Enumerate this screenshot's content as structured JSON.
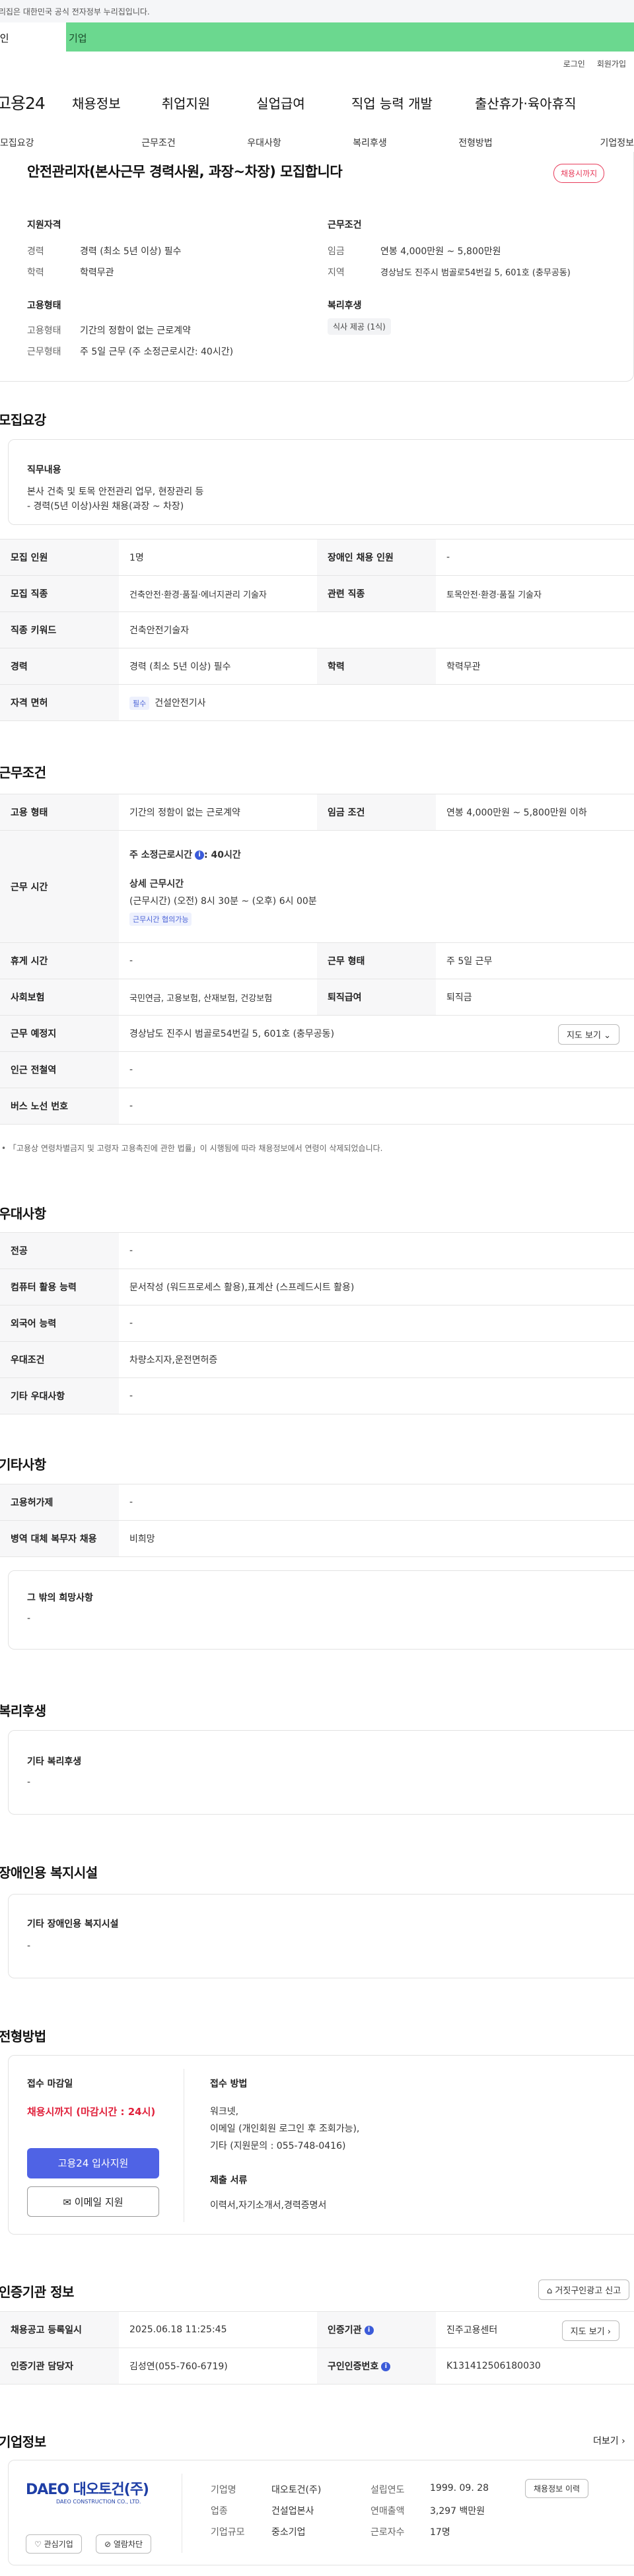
{
  "topbar": {
    "notice": "이 누리집은 대한민국 공식 전자정부 누리집입니다."
  },
  "audience": {
    "personal": "개인",
    "company": "기업"
  },
  "util": {
    "login": "로그인",
    "signup": "회원가입"
  },
  "gnb": {
    "logo": "고용24",
    "items": [
      "채용정보",
      "취업지원",
      "실업급여",
      "직업 능력 개발",
      "출산휴가·육아휴직"
    ]
  },
  "tabs": [
    "모집요강",
    "근무조건",
    "우대사항",
    "복리후생",
    "전형방법",
    "기업정보"
  ],
  "summary": {
    "title": "안전관리자(본사근무 경력사원, 과장~차장) 모집합니다",
    "badge": "채용시까지",
    "qual_heading": "지원자격",
    "career_label": "경력",
    "career_value": "경력 (최소 5년 이상) 필수",
    "edu_label": "학력",
    "edu_value": "학력무관",
    "cond_heading": "근무조건",
    "wage_label": "임금",
    "wage_value": "연봉 4,000만원 ~ 5,800만원",
    "region_label": "지역",
    "region_value": "경상남도 진주시 범골로54번길 5, 601호 (충무공동)",
    "emp_heading": "고용형태",
    "emptype_label": "고용형태",
    "emptype_value": "기간의 정함이 없는 근로계약",
    "worktype_label": "근무형태",
    "worktype_value": "주 5일 근무 (주 소정근로시간: 40시간)",
    "welfare_heading": "복리후생",
    "welfare_tag": "식사 제공 (1식)"
  },
  "recruit": {
    "heading": "모집요강",
    "duty_heading": "직무내용",
    "duty_line1": "본사 건축 및 토목 안전관리 업무, 현장관리 등",
    "duty_line2": "- 경력(5년 이상)사원 채용(과장 ~ 차장)",
    "rows": {
      "headcount_l": "모집 인원",
      "headcount_v": "1명",
      "disabled_l": "장애인 채용 인원",
      "disabled_v": "-",
      "job_l": "모집 직종",
      "job_v": "건축안전·환경·품질·에너지관리 기술자",
      "related_l": "관련 직종",
      "related_v": "토목안전·환경·품질 기술자",
      "keyword_l": "직종 키워드",
      "keyword_v": "건축안전기술자",
      "career_l": "경력",
      "career_v": "경력 (최소 5년 이상) 필수",
      "edu_l": "학력",
      "edu_v": "학력무관",
      "license_l": "자격 면허",
      "license_tag": "필수",
      "license_v": "건설안전기사"
    }
  },
  "workcond": {
    "heading": "근무조건",
    "emptype_l": "고용 형태",
    "emptype_v": "기간의 정함이 없는 근로계약",
    "wage_l": "임금 조건",
    "wage_v": "연봉 4,000만원 ~ 5,800만원 이하",
    "hours_l": "근무 시간",
    "weekly_label": "주 소정근로시간",
    "weekly_value": ": 40시간",
    "detail_label": "상세 근무시간",
    "detail_value": "(근무시간) (오전) 8시 30분 ~ (오후) 6시 00분",
    "consult_tag": "근무시간 협의가능",
    "holiday_l": "휴게 시간",
    "holiday_v": "-",
    "shift_l": "근무 형태",
    "shift_v": "주 5일 근무",
    "insurance_l": "사회보험",
    "insurance_v": "국민연금, 고용보험, 산재보험, 건강보험",
    "retire_l": "퇴직급여",
    "retire_v": "퇴직금",
    "place_l": "근무 예정지",
    "place_v": "경상남도 진주시 범골로54번길 5, 601호 (충무공동)",
    "map_btn": "지도 보기",
    "station_l": "인근 전철역",
    "station_v": "-",
    "bus_l": "버스 노선 번호",
    "bus_v": "-",
    "footnote": "「고용상 연령차별금지 및 고령자 고용촉진에 관한 법률」이 시행됨에 따라 채용정보에서 연령이 삭제되었습니다."
  },
  "pref": {
    "heading": "우대사항",
    "major_l": "전공",
    "major_v": "-",
    "computer_l": "컴퓨터 활용 능력",
    "computer_v": "문서작성 (워드프로세스 활용),표계산 (스프레드시트 활용)",
    "lang_l": "외국어 능력",
    "lang_v": "-",
    "cond_l": "우대조건",
    "cond_v": "차량소지자,운전면허증",
    "etc_l": "기타 우대사항",
    "etc_v": "-"
  },
  "other": {
    "heading": "기타사항",
    "permit_l": "고용허가제",
    "permit_v": "-",
    "military_l": "병역 대체 복무자 채용",
    "military_v": "비희망",
    "hope_heading": "그 밖의 희망사항",
    "hope_v": "-"
  },
  "welfare": {
    "heading": "복리후생",
    "sub": "기타 복리후생",
    "v": "-"
  },
  "disab": {
    "heading": "장애인용 복지시설",
    "sub": "기타 장애인용 복지시설",
    "v": "-"
  },
  "selection": {
    "heading": "전형방법",
    "deadline_l": "접수 마감일",
    "deadline_v": "채용시까지 (마감시간 : 24시)",
    "apply_btn": "고용24 입사지원",
    "email_btn": "이메일 지원",
    "method_l": "접수 방법",
    "method_1": "워크넷,",
    "method_2": "이메일 (개인회원 로그인 후 조회가능),",
    "method_3": "기타 (지원문의 : 055-748-0416)",
    "docs_l": "제출 서류",
    "docs_v": "이력서,자기소개서,경력증명서"
  },
  "cert": {
    "heading": "인증기관 정보",
    "report_btn": "거짓구인광고 신고",
    "reg_l": "채용공고 등록일시",
    "reg_v": "2025.06.18 11:25:45",
    "org_l": "인증기관",
    "org_v": "진주고용센터",
    "map_btn": "지도 보기",
    "mgr_l": "인증기관 담당자",
    "mgr_v": "김성연(055-760-6719)",
    "no_l": "구인인증번호",
    "no_v": "K131412506180030"
  },
  "company": {
    "heading": "기업정보",
    "more": "더보기",
    "logo_main": "DAEO 대오토건(주)",
    "logo_sub": "DAEO CONSTRUCTION CO., LTD.",
    "fav_btn": "관심기업",
    "block_btn": "열람차단",
    "name_l": "기업명",
    "name_v": "대오토건(주)",
    "ind_l": "업종",
    "ind_v": "건설업본사",
    "size_l": "기업규모",
    "size_v": "중소기업",
    "est_l": "설립연도",
    "est_v": "1999. 09. 28",
    "rev_l": "연매출액",
    "rev_v": "3,297 백만원",
    "emp_l": "근로자수",
    "emp_v": "17명",
    "jobs_btn": "채용정보 이력"
  },
  "colors": {
    "accent": "#4f63e5",
    "green": "#6bd88f",
    "red": "#e0203a"
  }
}
